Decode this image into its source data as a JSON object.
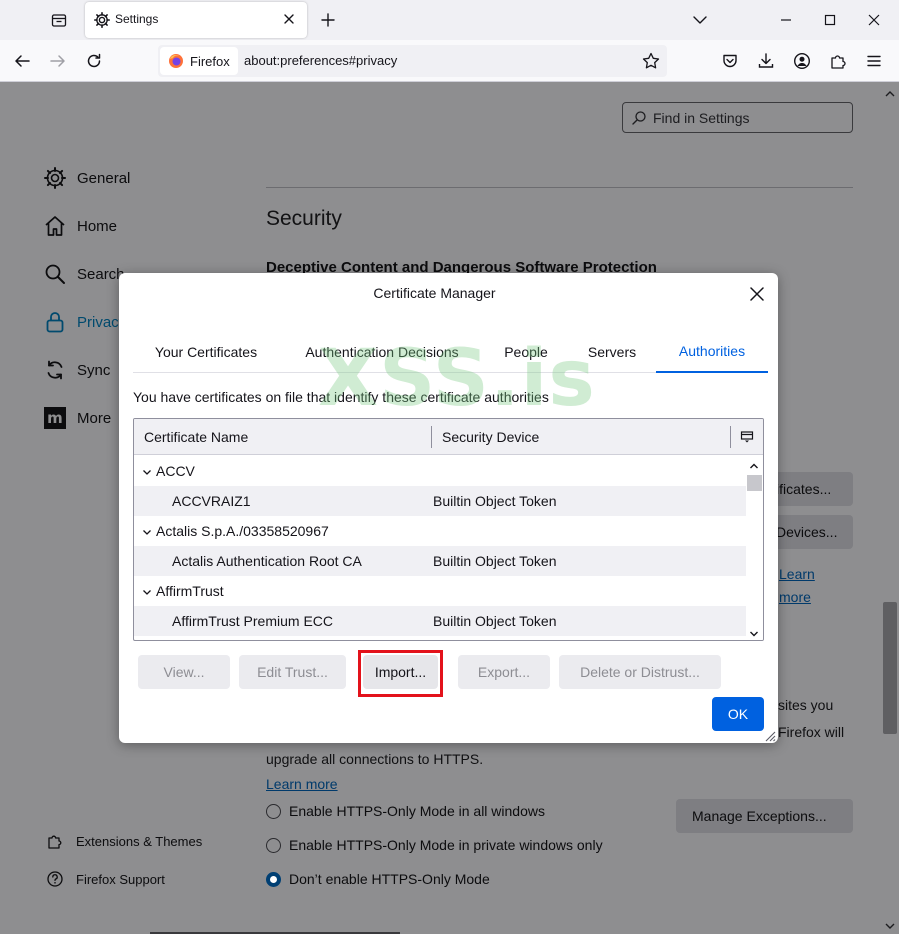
{
  "browser": {
    "tab_title": "Settings",
    "identity_label": "Firefox",
    "url": "about:preferences#privacy"
  },
  "page": {
    "find_placeholder": "Find in Settings",
    "sidebar": [
      {
        "label": "General",
        "icon": "gear-icon"
      },
      {
        "label": "Home",
        "icon": "home-icon"
      },
      {
        "label": "Search",
        "icon": "search-icon"
      },
      {
        "label": "Privacy",
        "icon": "lock-icon"
      },
      {
        "label": "Sync",
        "icon": "sync-icon"
      },
      {
        "label": "More",
        "icon": "mozilla-icon"
      }
    ],
    "sidebar_bottom": [
      {
        "label": "Extensions & Themes",
        "icon": "puzzle-icon"
      },
      {
        "label": "Firefox Support",
        "icon": "help-icon"
      }
    ],
    "section_title": "Security",
    "subsection_title": "Deceptive Content and Dangerous Software Protection",
    "partial": {
      "view_certificates": "ificates...",
      "security_devices": "Devices...",
      "learn": "Learn",
      "more": "more",
      "sites_you": "sites you",
      "firefox_will": "Firefox will"
    },
    "https_upgrade_text": "upgrade all connections to HTTPS.",
    "learn_more": "Learn more",
    "https_options": [
      {
        "label": "Enable HTTPS-Only Mode in all windows",
        "checked": false
      },
      {
        "label": "Enable HTTPS-Only Mode in private windows only",
        "checked": false
      },
      {
        "label": "Don’t enable HTTPS-Only Mode",
        "checked": true
      }
    ],
    "manage_exceptions": "Manage Exceptions..."
  },
  "dialog": {
    "title": "Certificate Manager",
    "tabs": [
      "Your Certificates",
      "Authentication Decisions",
      "People",
      "Servers",
      "Authorities"
    ],
    "selected_tab": "Authorities",
    "description": "You have certificates on file that identify these certificate authorities",
    "columns": [
      "Certificate Name",
      "Security Device"
    ],
    "rows": [
      {
        "name": "ACCV",
        "device": "",
        "group": true
      },
      {
        "name": "ACCVRAIZ1",
        "device": "Builtin Object Token",
        "group": false
      },
      {
        "name": "Actalis S.p.A./03358520967",
        "device": "",
        "group": true
      },
      {
        "name": "Actalis Authentication Root CA",
        "device": "Builtin Object Token",
        "group": false
      },
      {
        "name": "AffirmTrust",
        "device": "",
        "group": true
      },
      {
        "name": "AffirmTrust Premium ECC",
        "device": "Builtin Object Token",
        "group": false
      }
    ],
    "buttons": {
      "view": "View...",
      "edit_trust": "Edit Trust...",
      "import": "Import...",
      "export": "Export...",
      "delete": "Delete or Distrust..."
    },
    "ok": "OK"
  },
  "watermark": "XSS.is",
  "colors": {
    "accent": "#0061e0",
    "highlight": "#e3121b"
  }
}
